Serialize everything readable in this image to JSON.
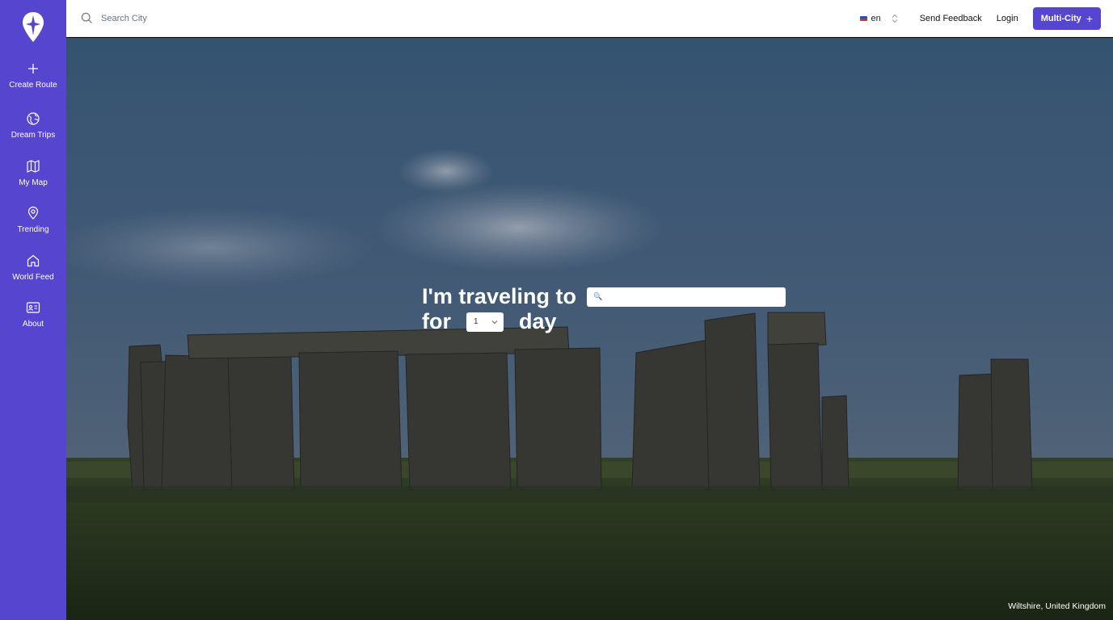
{
  "sidebar": {
    "logo_icon": "compass-pin-logo",
    "items": [
      {
        "label": "Create Route",
        "icon": "plus-icon"
      },
      {
        "label": "Dream Trips",
        "icon": "globe-icon"
      },
      {
        "label": "My Map",
        "icon": "map-icon"
      },
      {
        "label": "Trending",
        "icon": "location-pin-icon"
      },
      {
        "label": "World Feed",
        "icon": "home-icon"
      },
      {
        "label": "About",
        "icon": "id-card-icon"
      }
    ],
    "accent_color": "#5645cf"
  },
  "topbar": {
    "search_placeholder": "Search City",
    "language": "en",
    "send_feedback": "Send Feedback",
    "login": "Login",
    "multi_city": "Multi-City"
  },
  "hero": {
    "prompt_start": "I'm traveling to",
    "prompt_for": "for",
    "days_value": "1",
    "prompt_day": "day",
    "destination_value": "",
    "photo_location": "Wiltshire, United Kingdom"
  }
}
